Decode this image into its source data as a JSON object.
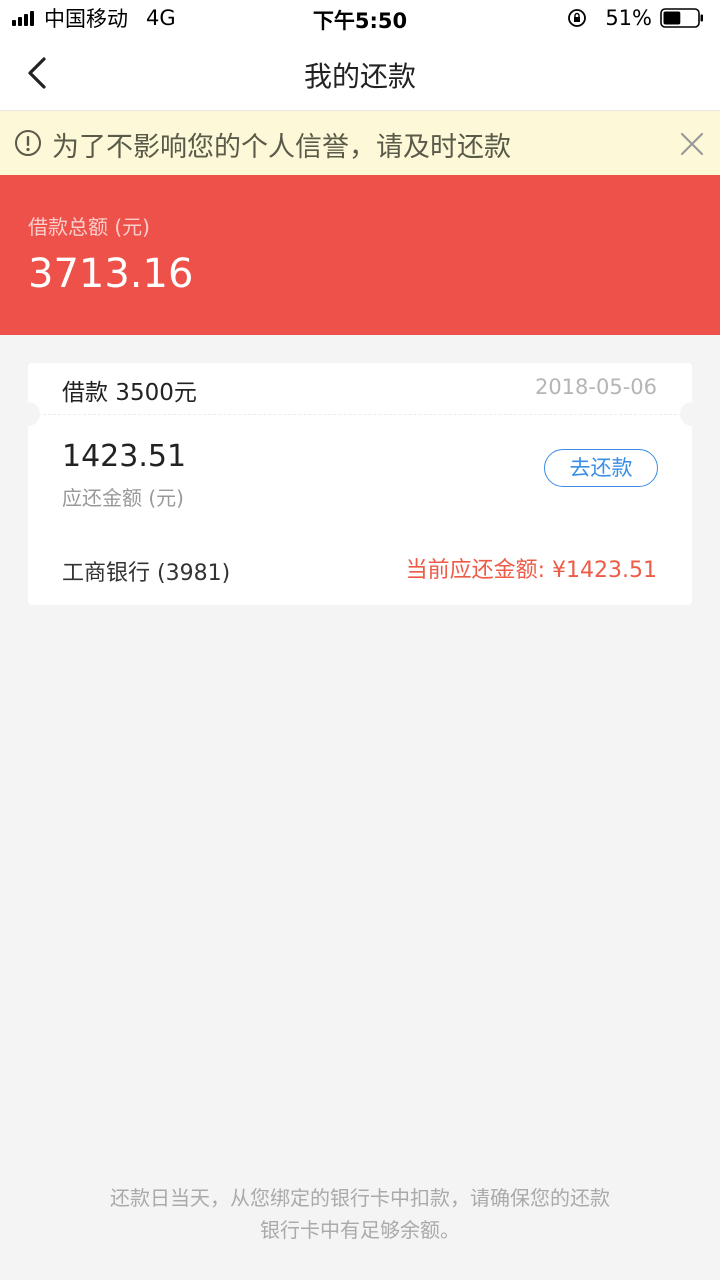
{
  "status_bar": {
    "carrier": "中国移动",
    "network": "4G",
    "time": "下午5:50",
    "battery_percent": "51%",
    "battery_level": 0.51
  },
  "nav": {
    "title": "我的还款",
    "back_icon": "chevron-left-icon"
  },
  "notice": {
    "text": "为了不影响您的个人信誉，请及时还款",
    "icon": "exclamation-circle-icon",
    "close_icon": "close-icon",
    "background": "#fdf9d8"
  },
  "summary": {
    "label": "借款总额 (元)",
    "amount": "3713.16",
    "background": "#ee514a"
  },
  "loan": {
    "title": "借款 3500元",
    "date": "2018-05-06",
    "due_amount": "1423.51",
    "due_label": "应还金额 (元)",
    "repay_button": "去还款",
    "bank": "工商银行 (3981)",
    "current_due": "当前应还金额: ¥1423.51"
  },
  "footer": {
    "line1": "还款日当天，从您绑定的银行卡中扣款，请确保您的还款",
    "line2": "银行卡中有足够余额。"
  },
  "colors": {
    "accent_blue": "#3a8ee6",
    "accent_red": "#ee5b47"
  }
}
